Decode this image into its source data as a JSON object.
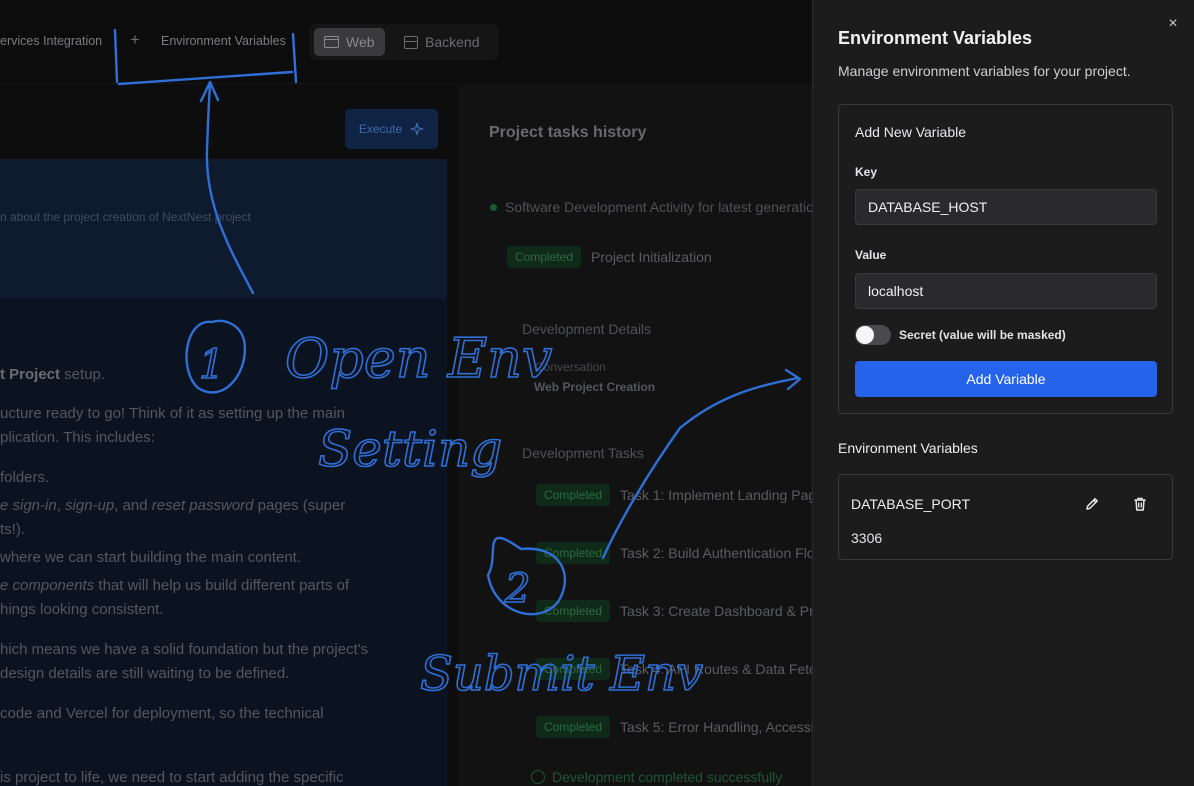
{
  "topbar": {
    "tab_services": "ervices Integration",
    "tab_env": "Environment Variables",
    "view_web": "Web",
    "view_backend": "Backend"
  },
  "left": {
    "execute_label": "Execute",
    "description": "n about the project creation of NextNest project",
    "lines": {
      "l1_bold": "t Project",
      "l1_rest": " setup.",
      "l2": "ucture ready to go! Think of it as setting up the main",
      "l3": "plication. This includes:",
      "l4": "folders.",
      "l5_a": "e sign-in",
      "l5_b": ", ",
      "l5_c": "sign-up",
      "l5_d": ", and ",
      "l5_e": "reset password",
      "l5_f": " pages (super",
      "l6": "ts!).",
      "l7": " where we can start building the main content.",
      "l8_a": "e components",
      "l8_b": " that will help us build different parts of",
      "l9": "hings looking consistent.",
      "l10": "hich means we have a solid foundation but the project's",
      "l11": " design details are still waiting to be defined.",
      "l12": "code and Vercel for deployment, so the technical",
      "l13": "is project to life, we need to start adding the specific"
    }
  },
  "history": {
    "title": "Project tasks history",
    "activity": "Software Development Activity for latest generatio",
    "completed_label": "Completed",
    "project_init": "Project Initialization",
    "dev_details": "Development Details",
    "conversation_label": "Conversation",
    "conversation_value": "Web Project Creation",
    "dev_tasks": "Development Tasks",
    "tasks": [
      "Task 1: Implement Landing Pag",
      "Task 2: Build Authentication Flo",
      "Task 3: Create Dashboard & Pr",
      "Task 4: API Routes & Data Fetc",
      "Task 5: Error Handling, Accessi"
    ],
    "success": "Development completed successfully"
  },
  "drawer": {
    "title": "Environment Variables",
    "description": "Manage environment variables for your project.",
    "close_icon": "×",
    "add_card": {
      "title": "Add New Variable",
      "key_label": "Key",
      "key_value": "DATABASE_HOST",
      "value_label": "Value",
      "value_value": "localhost",
      "secret_label": "Secret (value will be masked)",
      "secret_on": false,
      "add_button": "Add Variable"
    },
    "list_title": "Environment Variables",
    "variables": [
      {
        "key": "DATABASE_PORT",
        "value": "3306"
      }
    ]
  },
  "annotations": {
    "step1_number": "1",
    "step1_text_a": "Open Env",
    "step1_text_b": "Setting",
    "step2_number": "2",
    "step2_text": "Submit Env"
  },
  "colors": {
    "accent": "#2563eb",
    "annotation_ink": "#2f6fd6",
    "drawer_bg": "#1c1c1d"
  }
}
